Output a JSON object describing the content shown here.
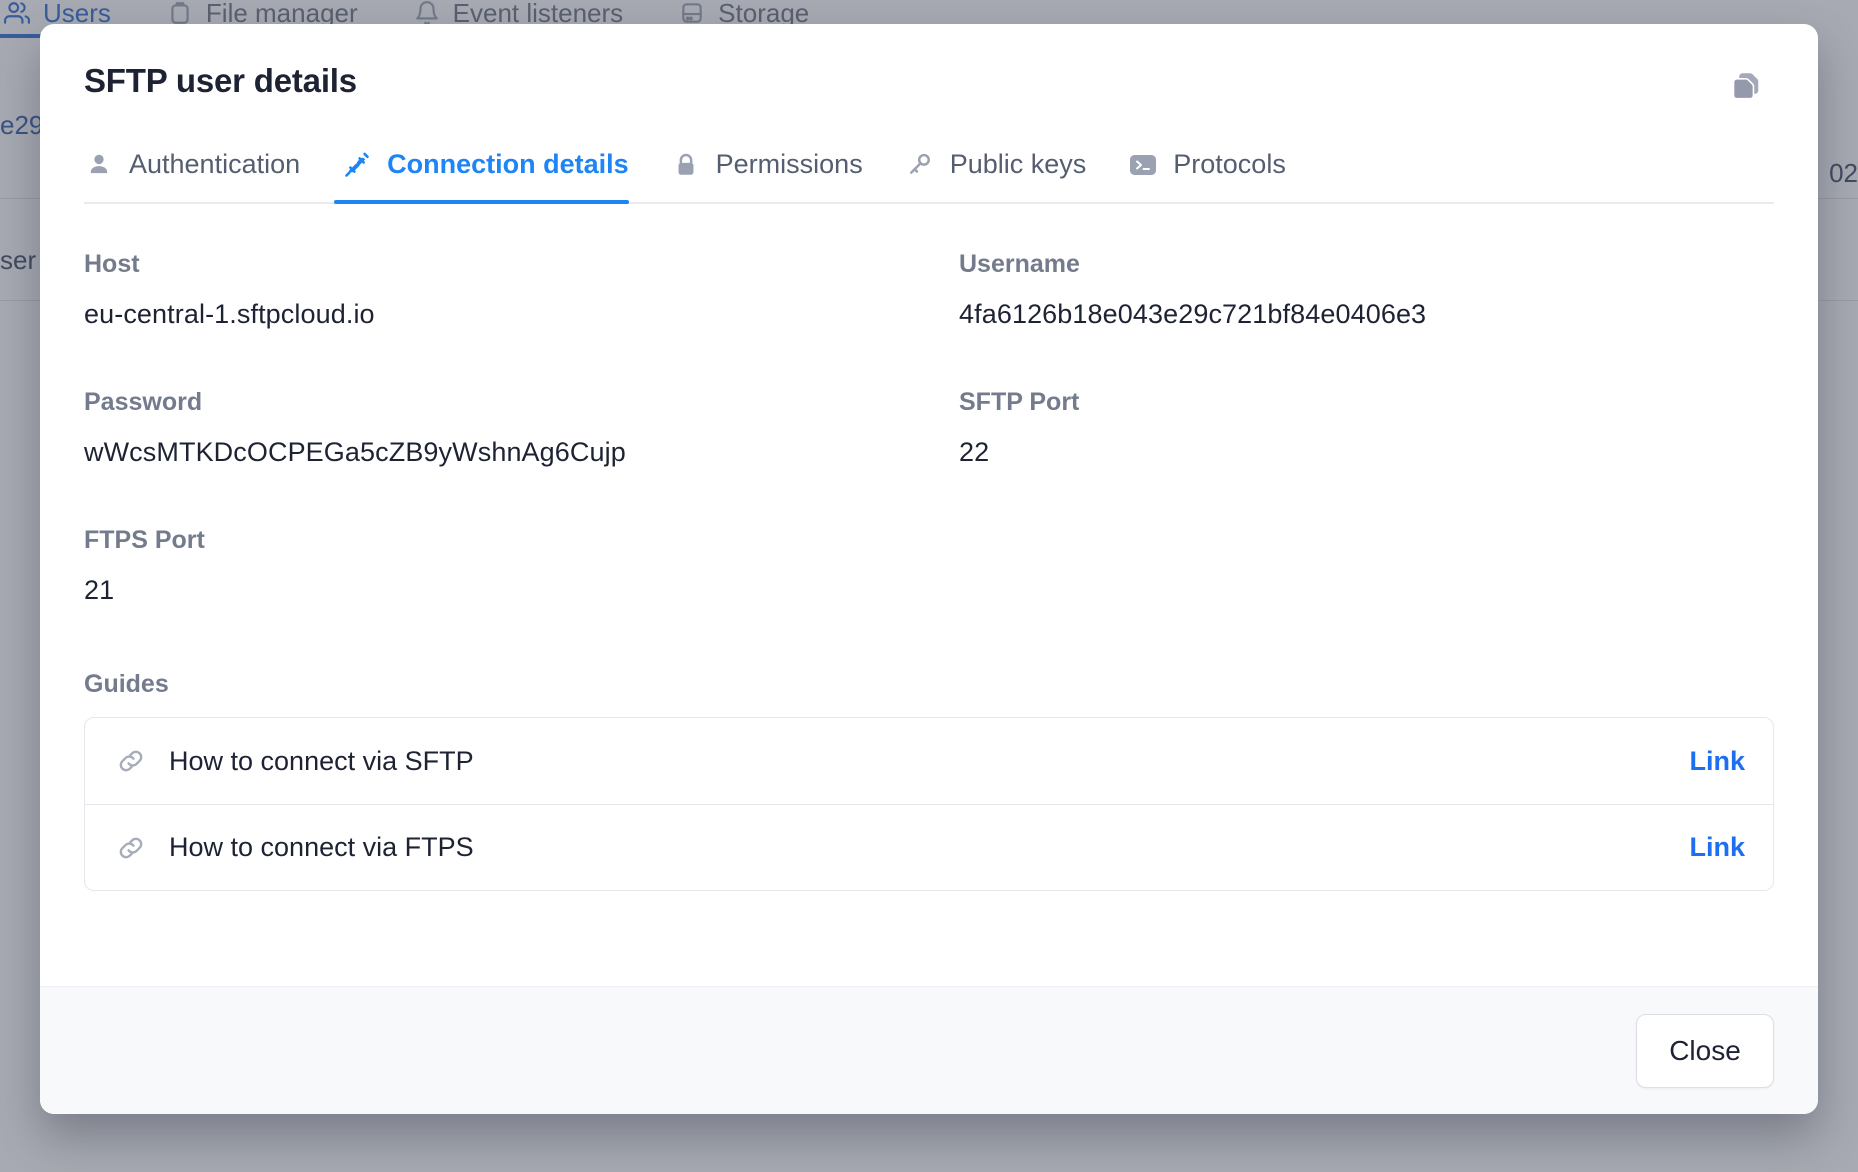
{
  "background": {
    "nav": [
      {
        "label": "Users",
        "icon": "users-icon",
        "active": true
      },
      {
        "label": "File manager",
        "icon": "folder-icon",
        "active": false
      },
      {
        "label": "Event listeners",
        "icon": "bell-icon",
        "active": false
      },
      {
        "label": "Storage",
        "icon": "database-icon",
        "active": false
      }
    ],
    "partial_rows": [
      {
        "text": "e29",
        "color": "#3158a8"
      },
      {
        "text": "ser",
        "color": "#3f4a63"
      },
      {
        "text": "02",
        "color": "#3f4a63"
      }
    ]
  },
  "modal": {
    "title": "SFTP user details",
    "copy_icon": "copy-icon",
    "tabs": [
      {
        "label": "Authentication",
        "icon": "user-icon",
        "active": false
      },
      {
        "label": "Connection details",
        "icon": "plug-connect-icon",
        "active": true
      },
      {
        "label": "Permissions",
        "icon": "lock-icon",
        "active": false
      },
      {
        "label": "Public keys",
        "icon": "key-icon",
        "active": false
      },
      {
        "label": "Protocols",
        "icon": "terminal-icon",
        "active": false
      }
    ],
    "fields": [
      {
        "label": "Host",
        "value": "eu-central-1.sftpcloud.io"
      },
      {
        "label": "Username",
        "value": "4fa6126b18e043e29c721bf84e0406e3"
      },
      {
        "label": "Password",
        "value": "wWcsMTKDcOCPEGa5cZB9yWshnAg6Cujp"
      },
      {
        "label": "SFTP Port",
        "value": "22"
      },
      {
        "label": "FTPS Port",
        "value": "21"
      }
    ],
    "guides": {
      "label": "Guides",
      "items": [
        {
          "icon": "link-icon",
          "text": "How to connect via SFTP",
          "link_label": "Link"
        },
        {
          "icon": "link-icon",
          "text": "How to connect via FTPS",
          "link_label": "Link"
        }
      ]
    },
    "footer": {
      "close_label": "Close"
    }
  },
  "colors": {
    "accent_blue": "#1d85f5",
    "link_blue": "#1d6ff2",
    "label_gray": "#737b8c",
    "text_dark": "#1d2333",
    "backdrop": "#8b909e"
  }
}
